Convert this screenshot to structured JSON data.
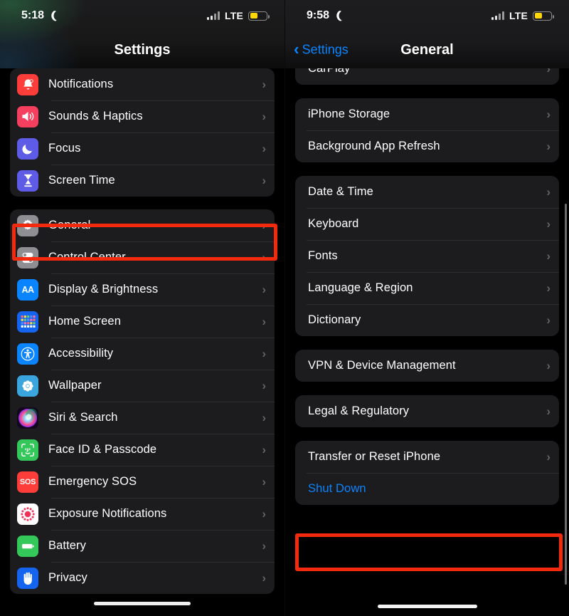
{
  "left": {
    "status": {
      "time": "5:18",
      "moon_icon": "moon-icon",
      "carrier": "LTE",
      "signal_icon": "signal-bars-icon",
      "battery_icon": "battery-low-power-icon"
    },
    "nav": {
      "title": "Settings"
    },
    "groups": [
      {
        "rows": [
          {
            "label": "Notifications",
            "icon": "bell-icon",
            "color": "#fc3d39"
          },
          {
            "label": "Sounds & Haptics",
            "icon": "speaker-icon",
            "color": "#f43f5e"
          },
          {
            "label": "Focus",
            "icon": "crescent-moon-icon",
            "color": "#5e5ce6"
          },
          {
            "label": "Screen Time",
            "icon": "hourglass-icon",
            "color": "#5e5ce6"
          }
        ]
      },
      {
        "rows": [
          {
            "label": "General",
            "icon": "gear-icon",
            "color": "#8e8e93",
            "highlighted": true
          },
          {
            "label": "Control Center",
            "icon": "toggles-icon",
            "color": "#8e8e93"
          },
          {
            "label": "Display & Brightness",
            "icon": "text-size-icon",
            "color": "#0a84ff"
          },
          {
            "label": "Home Screen",
            "icon": "app-grid-icon",
            "color": "#1464f0"
          },
          {
            "label": "Accessibility",
            "icon": "accessibility-icon",
            "color": "#0a84ff"
          },
          {
            "label": "Wallpaper",
            "icon": "flower-icon",
            "color": "#3aa6dd"
          },
          {
            "label": "Siri & Search",
            "icon": "siri-orb-icon",
            "color": "#1c1c1e"
          },
          {
            "label": "Face ID & Passcode",
            "icon": "face-id-icon",
            "color": "#34c759"
          },
          {
            "label": "Emergency SOS",
            "icon": "sos-icon",
            "color": "#fc3d39"
          },
          {
            "label": "Exposure Notifications",
            "icon": "exposure-icon",
            "color": "#ffffff"
          },
          {
            "label": "Battery",
            "icon": "battery-icon",
            "color": "#34c759"
          },
          {
            "label": "Privacy",
            "icon": "hand-icon",
            "color": "#1464f0"
          }
        ]
      }
    ]
  },
  "right": {
    "status": {
      "time": "9:58",
      "moon_icon": "moon-icon",
      "carrier": "LTE",
      "signal_icon": "signal-bars-icon",
      "battery_icon": "battery-low-power-icon"
    },
    "nav": {
      "back_label": "Settings",
      "back_icon": "chevron-left-icon",
      "title": "General"
    },
    "groups": [
      {
        "clipped": true,
        "rows": [
          {
            "label": "CarPlay"
          }
        ]
      },
      {
        "rows": [
          {
            "label": "iPhone Storage"
          },
          {
            "label": "Background App Refresh"
          }
        ]
      },
      {
        "rows": [
          {
            "label": "Date & Time"
          },
          {
            "label": "Keyboard"
          },
          {
            "label": "Fonts"
          },
          {
            "label": "Language & Region"
          },
          {
            "label": "Dictionary"
          }
        ]
      },
      {
        "rows": [
          {
            "label": "VPN & Device Management"
          }
        ]
      },
      {
        "rows": [
          {
            "label": "Legal & Regulatory"
          }
        ]
      },
      {
        "rows": [
          {
            "label": "Transfer or Reset iPhone"
          },
          {
            "label": "Shut Down",
            "blue": true,
            "no_chevron": true,
            "highlighted": true
          }
        ]
      }
    ]
  },
  "annotation": {
    "highlight_color": "#f42a0e",
    "accent_blue": "#0a84ff"
  }
}
